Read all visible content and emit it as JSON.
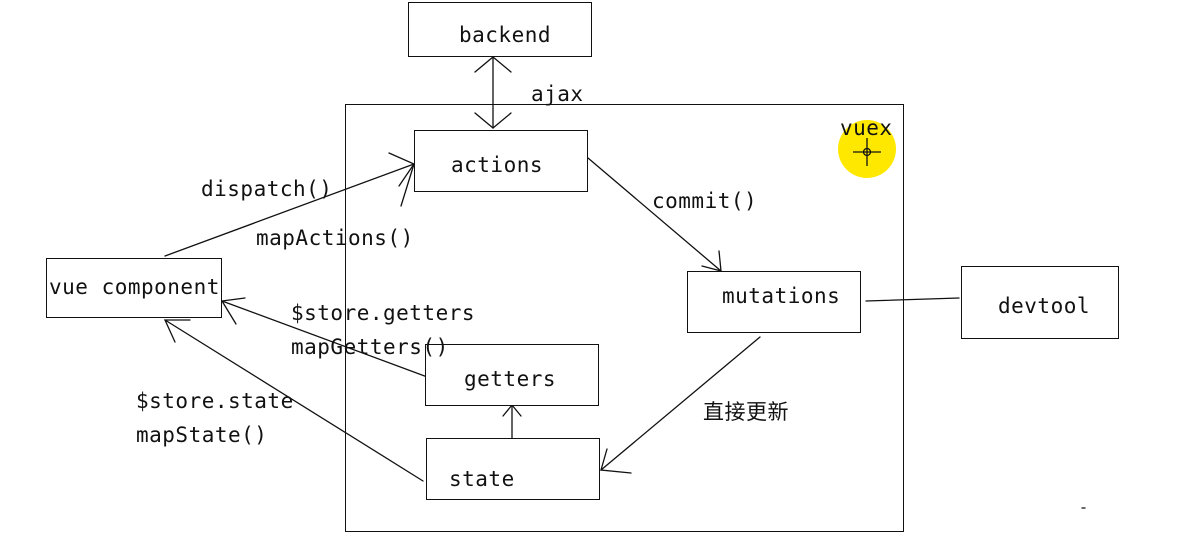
{
  "nodes": {
    "backend": "backend",
    "vuex": "vuex",
    "actions": "actions",
    "mutations": "mutations",
    "devtool": "devtool",
    "vue_component": "vue component",
    "getters": "getters",
    "state": "state"
  },
  "edge_labels": {
    "ajax": "ajax",
    "dispatch": "dispatch()",
    "map_actions": "mapActions()",
    "commit": "commit()",
    "store_getters": "$store.getters",
    "map_getters": "mapGetters()",
    "store_state": "$store.state",
    "map_state": "mapState()",
    "direct_update": "直接更新"
  },
  "colors": {
    "line": "#111111",
    "cursor_highlight": "#ffe800"
  },
  "icons": {
    "cursor": "crosshair-cursor-icon"
  }
}
